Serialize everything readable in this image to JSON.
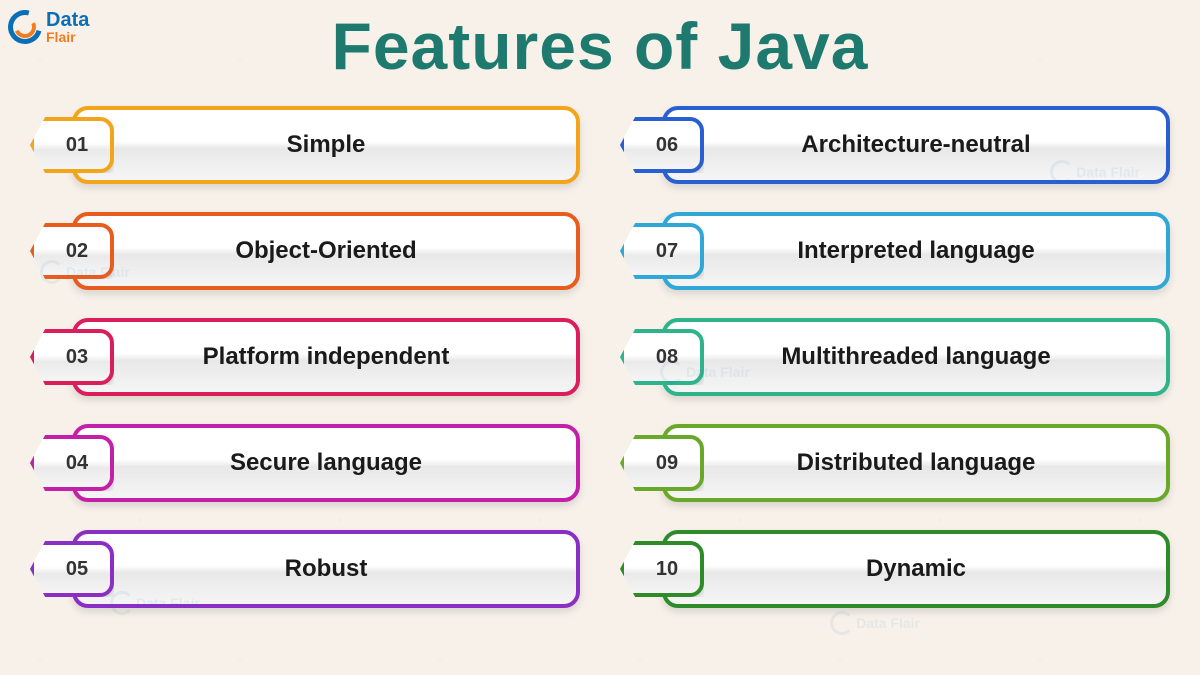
{
  "logo": {
    "line1": "Data",
    "line2": "Flair"
  },
  "title": "Features of Java",
  "colors": {
    "c01": "#f2a51a",
    "c02": "#e85c1e",
    "c03": "#d91e5b",
    "c04": "#c41fa8",
    "c05": "#8a2fc4",
    "c06": "#2a5fd1",
    "c07": "#2fa8d8",
    "c08": "#2fb38a",
    "c09": "#6aa82a",
    "c10": "#2f8a2a"
  },
  "left": [
    {
      "num": "01",
      "label": "Simple",
      "colorKey": "c01"
    },
    {
      "num": "02",
      "label": "Object-Oriented",
      "colorKey": "c02"
    },
    {
      "num": "03",
      "label": "Platform independent",
      "colorKey": "c03"
    },
    {
      "num": "04",
      "label": "Secure language",
      "colorKey": "c04"
    },
    {
      "num": "05",
      "label": "Robust",
      "colorKey": "c05"
    }
  ],
  "right": [
    {
      "num": "06",
      "label": "Architecture-neutral",
      "colorKey": "c06"
    },
    {
      "num": "07",
      "label": "Interpreted language",
      "colorKey": "c07"
    },
    {
      "num": "08",
      "label": "Multithreaded language",
      "colorKey": "c08"
    },
    {
      "num": "09",
      "label": "Distributed language",
      "colorKey": "c09"
    },
    {
      "num": "10",
      "label": "Dynamic",
      "colorKey": "c10"
    }
  ]
}
